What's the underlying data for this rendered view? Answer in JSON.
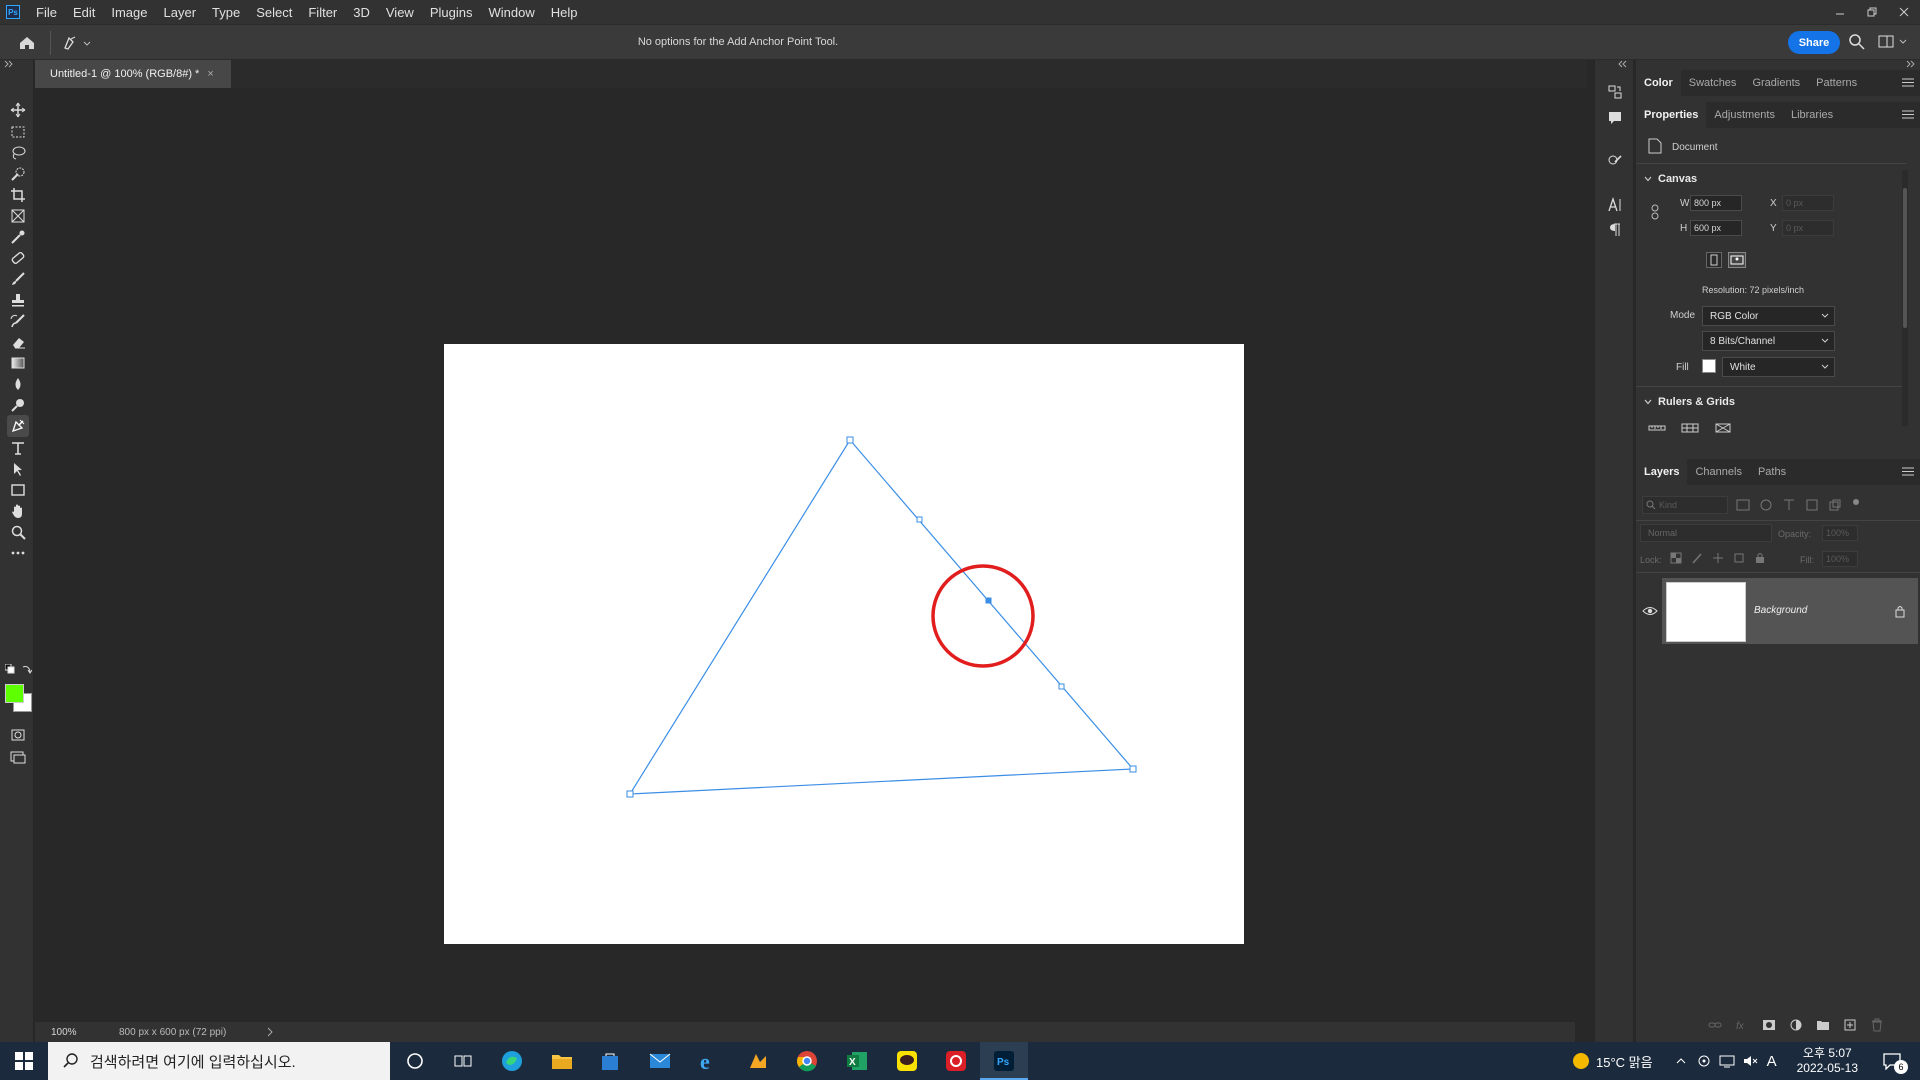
{
  "app": {
    "logo": "Ps",
    "menu": [
      "File",
      "Edit",
      "Image",
      "Layer",
      "Type",
      "Select",
      "Filter",
      "3D",
      "View",
      "Plugins",
      "Window",
      "Help"
    ]
  },
  "options_bar": {
    "message": "No options for the Add Anchor Point Tool.",
    "share_label": "Share"
  },
  "document": {
    "tab_title": "Untitled-1 @ 100% (RGB/8#) *",
    "tab_close": "×",
    "zoom": "100%",
    "doc_info": "800 px x 600 px (72 ppi)"
  },
  "colors": {
    "foreground": "#5eff00",
    "background": "#ffffff",
    "path": "#3a8ee6",
    "highlight_circle": "#e11d1d",
    "accent": "#1473e6"
  },
  "tools": [
    "move-icon",
    "marquee-icon",
    "lasso-icon",
    "quick-select-icon",
    "crop-icon",
    "frame-icon",
    "eyedropper-icon",
    "healing-icon",
    "brush-icon",
    "stamp-icon",
    "history-brush-icon",
    "eraser-icon",
    "gradient-icon",
    "blur-icon",
    "dodge-icon",
    "pen-icon",
    "type-icon",
    "path-select-icon",
    "rectangle-icon",
    "hand-icon",
    "zoom-icon",
    "more-icon"
  ],
  "panels": {
    "top_tabs": [
      "Color",
      "Swatches",
      "Gradients",
      "Patterns"
    ],
    "prop_tabs": [
      "Properties",
      "Adjustments",
      "Libraries"
    ],
    "doc_label": "Document",
    "canvas_section": "Canvas",
    "w_label": "W",
    "w_value": "800 px",
    "h_label": "H",
    "h_value": "600 px",
    "x_label": "X",
    "x_value": "0 px",
    "y_label": "Y",
    "y_value": "0 px",
    "resolution": "Resolution: 72 pixels/inch",
    "mode_label": "Mode",
    "mode_value": "RGB Color",
    "bits_value": "8 Bits/Channel",
    "fill_label": "Fill",
    "fill_value": "White",
    "rulers_section": "Rulers & Grids",
    "layer_tabs": [
      "Layers",
      "Channels",
      "Paths"
    ],
    "kind_placeholder": "Kind",
    "blend_mode": "Normal",
    "opacity_label": "Opacity:",
    "opacity_value": "100%",
    "lock_label": "Lock:",
    "fill2_label": "Fill:",
    "fill2_value": "100%",
    "layer_name": "Background"
  },
  "taskbar": {
    "search_placeholder": "검색하려면 여기에 입력하십시오.",
    "weather": "15°C 맑음",
    "time": "오후 5:07",
    "date": "2022-05-13",
    "ime": "A",
    "notification_count": "6"
  }
}
